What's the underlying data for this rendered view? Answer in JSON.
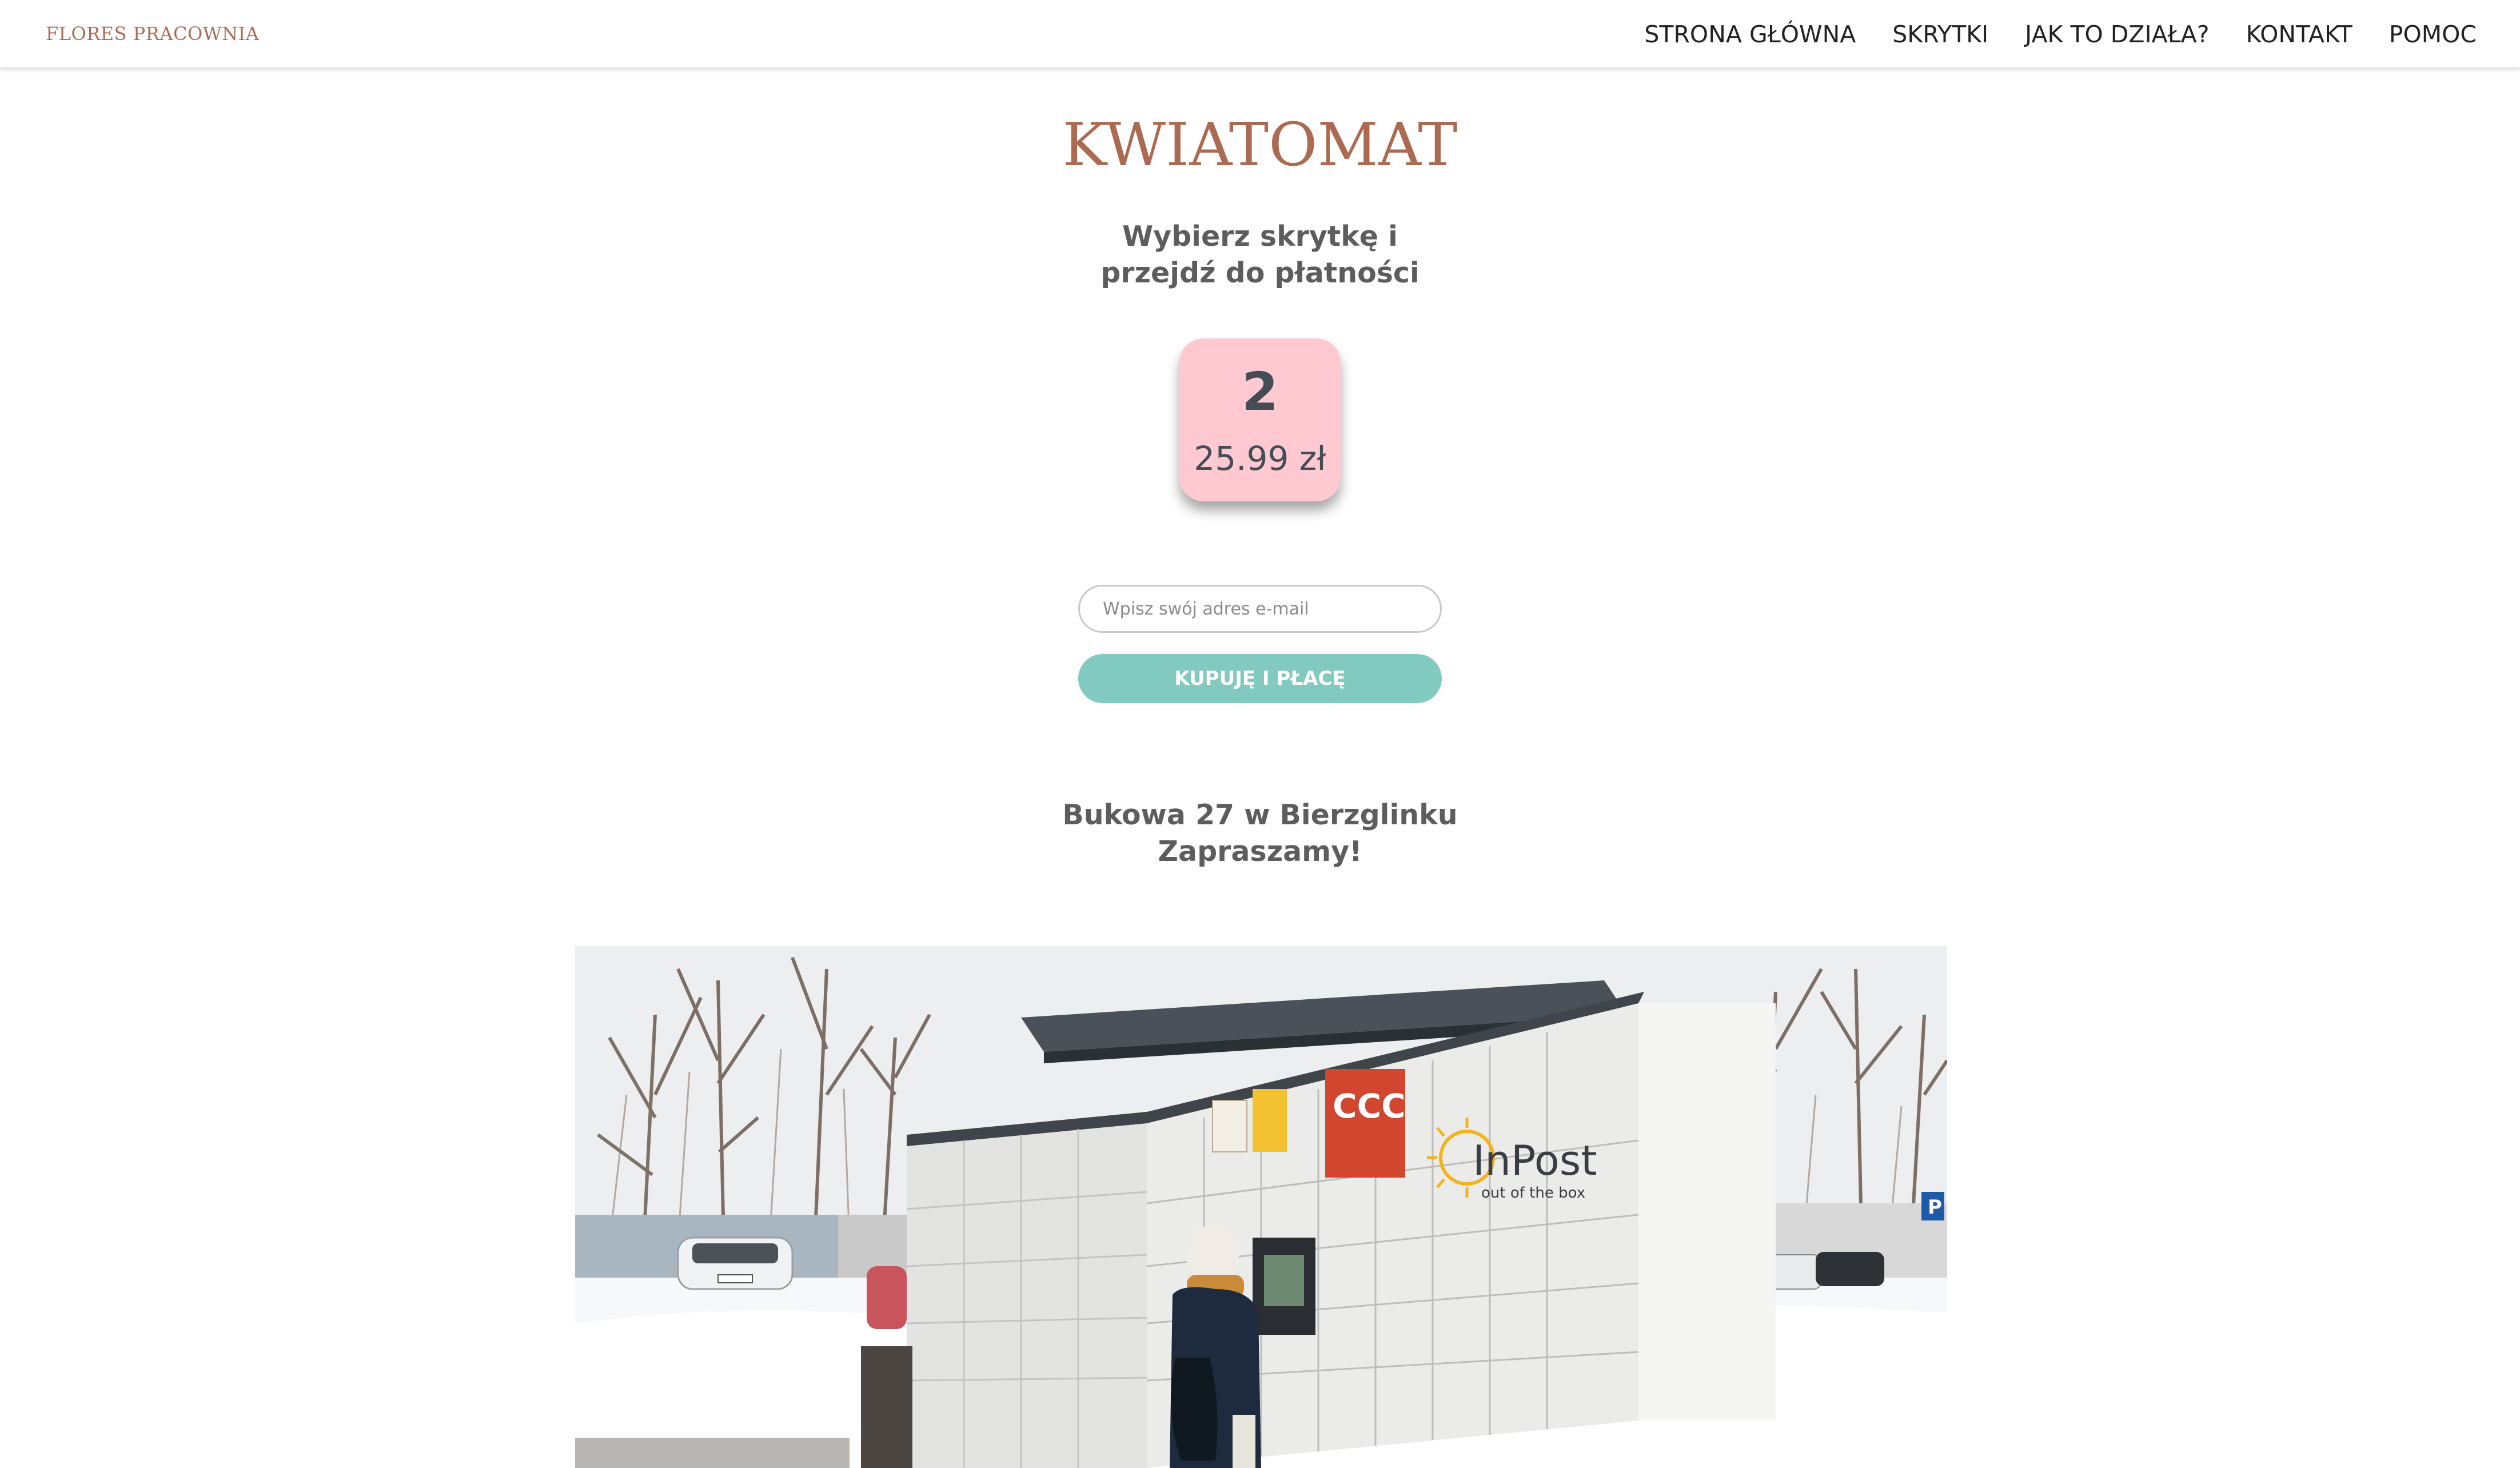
{
  "navbar": {
    "brand": "FLORES PRACOWNIA",
    "links": [
      "STRONA GŁÓWNA",
      "SKRYTKI",
      "JAK TO DZIAŁA?",
      "KONTAKT",
      "POMOC"
    ]
  },
  "main": {
    "title": "KWIATOMAT",
    "subtitle_line1": "Wybierz skrytkę i",
    "subtitle_line2": "przejdź do płatności",
    "locker": {
      "number": "2",
      "price": "25.99 zł"
    },
    "email_placeholder": "Wpisz swój adres e-mail",
    "email_value": "",
    "buy_button": "KUPUJĘ I PŁACĘ",
    "address_line1": "Bukowa 27 w Bierzglinku",
    "address_line2": "Zapraszamy!"
  },
  "photo": {
    "sign_ccc": "CCC",
    "sign_brand": "InPost",
    "sign_tagline": "out of the box",
    "parking_sign": "P"
  },
  "colors": {
    "brand": "#ad6a52",
    "card": "#ffc9d1",
    "button": "#82cac0",
    "text": "#5d5d5d"
  }
}
